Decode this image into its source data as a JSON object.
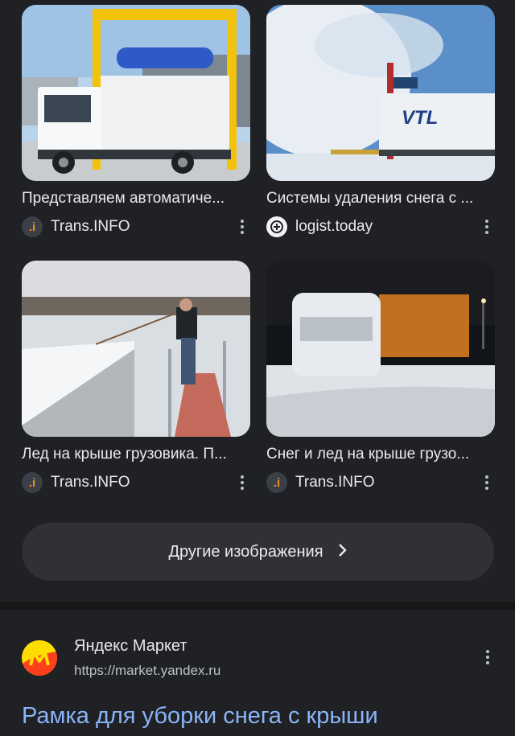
{
  "images": [
    {
      "title": "Представляем автоматиче...",
      "source": "Trans.INFO",
      "favicon": "trans-info-icon",
      "thumb": "truck-wash-gantry"
    },
    {
      "title": "Системы удаления снега с ...",
      "source": "logist.today",
      "favicon": "logist-today-icon",
      "thumb": "snow-blower-truck"
    },
    {
      "title": "Лед на крыше грузовика. П...",
      "source": "Trans.INFO",
      "favicon": "trans-info-icon",
      "thumb": "man-clearing-roof"
    },
    {
      "title": "Снег и лед на крыше грузо...",
      "source": "Trans.INFO",
      "favicon": "trans-info-icon",
      "thumb": "snowy-truck-night"
    }
  ],
  "more_images": {
    "label": "Другие изображения",
    "icon": "chevron-right-icon"
  },
  "result": {
    "site_name": "Яндекс Маркет",
    "url": "https://market.yandex.ru",
    "title": "Рамка для уборки снега с крыши",
    "logo_letter": "M"
  },
  "colors": {
    "background": "#202124",
    "link": "#8ab4f8",
    "brand_orange": "#f28b22",
    "yandex_yellow": "#ffdd00",
    "yandex_red": "#fc3f1d"
  }
}
